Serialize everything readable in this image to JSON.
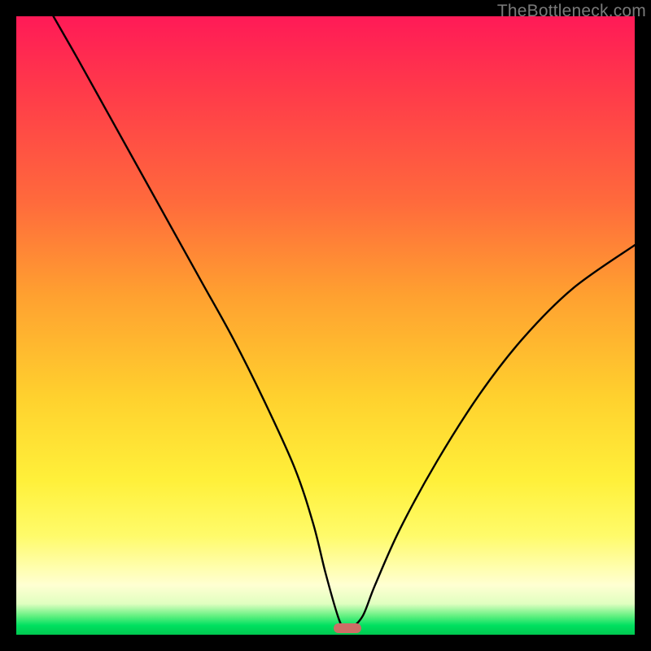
{
  "watermark": "TheBottleneck.com",
  "chart_data": {
    "type": "line",
    "title": "",
    "xlabel": "",
    "ylabel": "",
    "xlim": [
      0,
      100
    ],
    "ylim": [
      0,
      100
    ],
    "grid": false,
    "legend": false,
    "series": [
      {
        "name": "bottleneck-curve",
        "x": [
          6,
          10,
          15,
          20,
          25,
          30,
          35,
          40,
          45,
          48,
          50,
          52,
          53,
          54,
          56,
          58,
          62,
          68,
          75,
          82,
          90,
          100
        ],
        "values": [
          100,
          93,
          84,
          75,
          66,
          57,
          48,
          38,
          27,
          18,
          10,
          3,
          1,
          1,
          3,
          8,
          17,
          28,
          39,
          48,
          56,
          63
        ]
      }
    ],
    "annotations": [
      {
        "name": "optimal-marker",
        "x": 53.5,
        "y": 1
      }
    ],
    "background_gradient": {
      "stops": [
        {
          "pos": 0,
          "color": "#ff1a57"
        },
        {
          "pos": 30,
          "color": "#ff6a3c"
        },
        {
          "pos": 62,
          "color": "#ffd22e"
        },
        {
          "pos": 92,
          "color": "#ffffd2"
        },
        {
          "pos": 100,
          "color": "#00c850"
        }
      ]
    }
  }
}
